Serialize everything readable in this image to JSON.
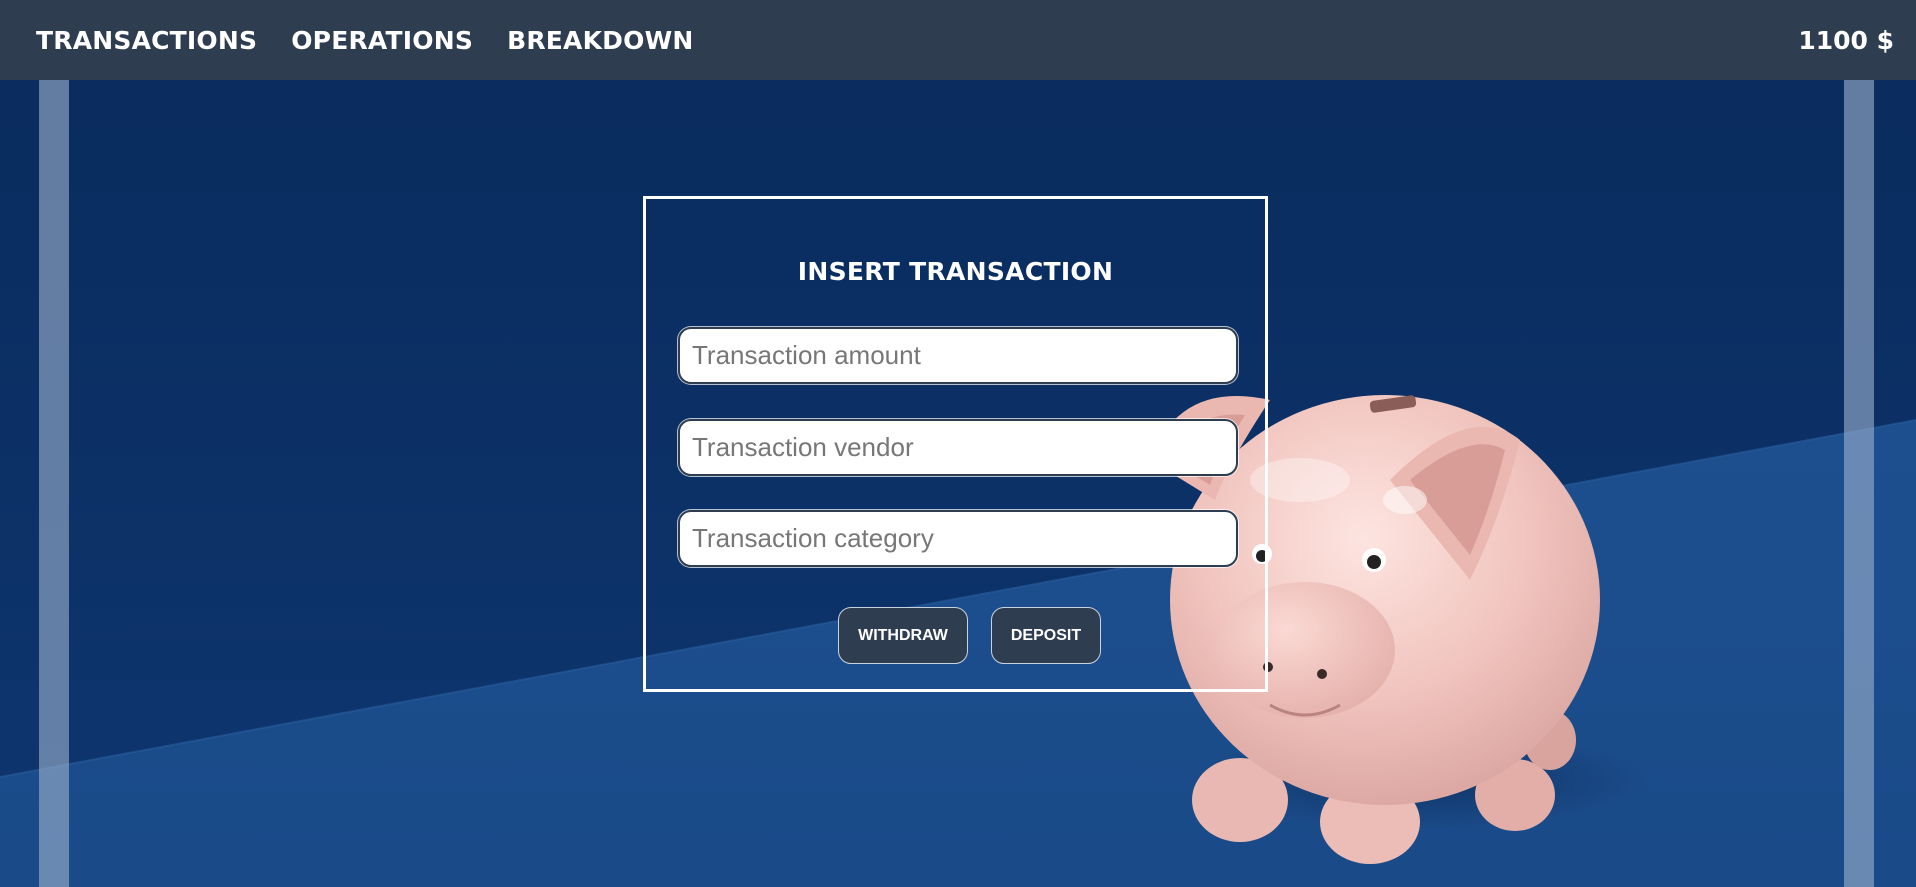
{
  "nav": {
    "items": [
      {
        "label": "TRANSACTIONS"
      },
      {
        "label": "OPERATIONS"
      },
      {
        "label": "BREAKDOWN"
      }
    ],
    "balance": "1100 $"
  },
  "form": {
    "title": "INSERT TRANSACTION",
    "amount_placeholder": "Transaction amount",
    "vendor_placeholder": "Transaction vendor",
    "category_placeholder": "Transaction category",
    "withdraw_label": "WITHDRAW",
    "deposit_label": "DEPOSIT"
  },
  "colors": {
    "navbar": "#2f3d50",
    "background_wall": "#0b2f62",
    "background_floor": "#1b4e8e",
    "piggy_bank": "#f0c2bd",
    "button": "#2f3d50",
    "text": "#ffffff"
  },
  "background_image": {
    "subject": "pink-piggy-bank"
  }
}
